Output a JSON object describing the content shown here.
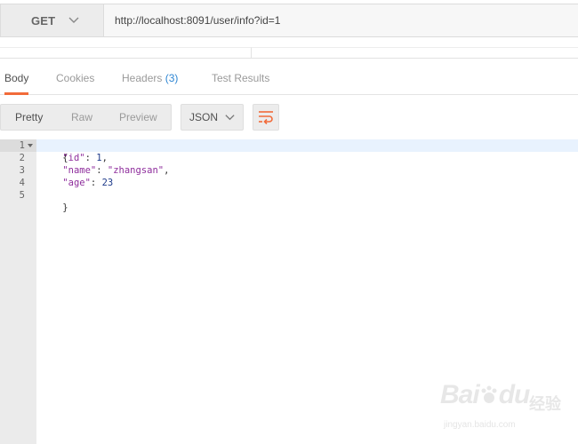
{
  "request": {
    "method": "GET",
    "url": "http://localhost:8091/user/info?id=1"
  },
  "response_tabs": [
    {
      "label": "Body",
      "active": true
    },
    {
      "label": "Cookies"
    },
    {
      "label": "Headers",
      "count": "(3)"
    },
    {
      "label": "Test Results"
    }
  ],
  "view_modes": [
    {
      "label": "Pretty",
      "active": true
    },
    {
      "label": "Raw"
    },
    {
      "label": "Preview"
    }
  ],
  "format": "JSON",
  "code_lines": [
    {
      "n": "1",
      "text": "{"
    },
    {
      "n": "2",
      "key": "\"id\"",
      "sep": ": ",
      "val": "1",
      "tail": ","
    },
    {
      "n": "3",
      "key": "\"name\"",
      "sep": ": ",
      "val": "\"zhangsan\"",
      "tail": ","
    },
    {
      "n": "4",
      "key": "\"age\"",
      "sep": ": ",
      "val": "23",
      "tail": ""
    },
    {
      "n": "5",
      "text": "}"
    }
  ],
  "watermark": {
    "brand": "Bai",
    "brand2": "du",
    "sub": "经验",
    "url": "jingyan.baidu.com"
  },
  "colors": {
    "accent": "#f26b3a",
    "count": "#2f86d3",
    "json_key": "#8e2d9c",
    "json_number": "#1e3a8a"
  }
}
